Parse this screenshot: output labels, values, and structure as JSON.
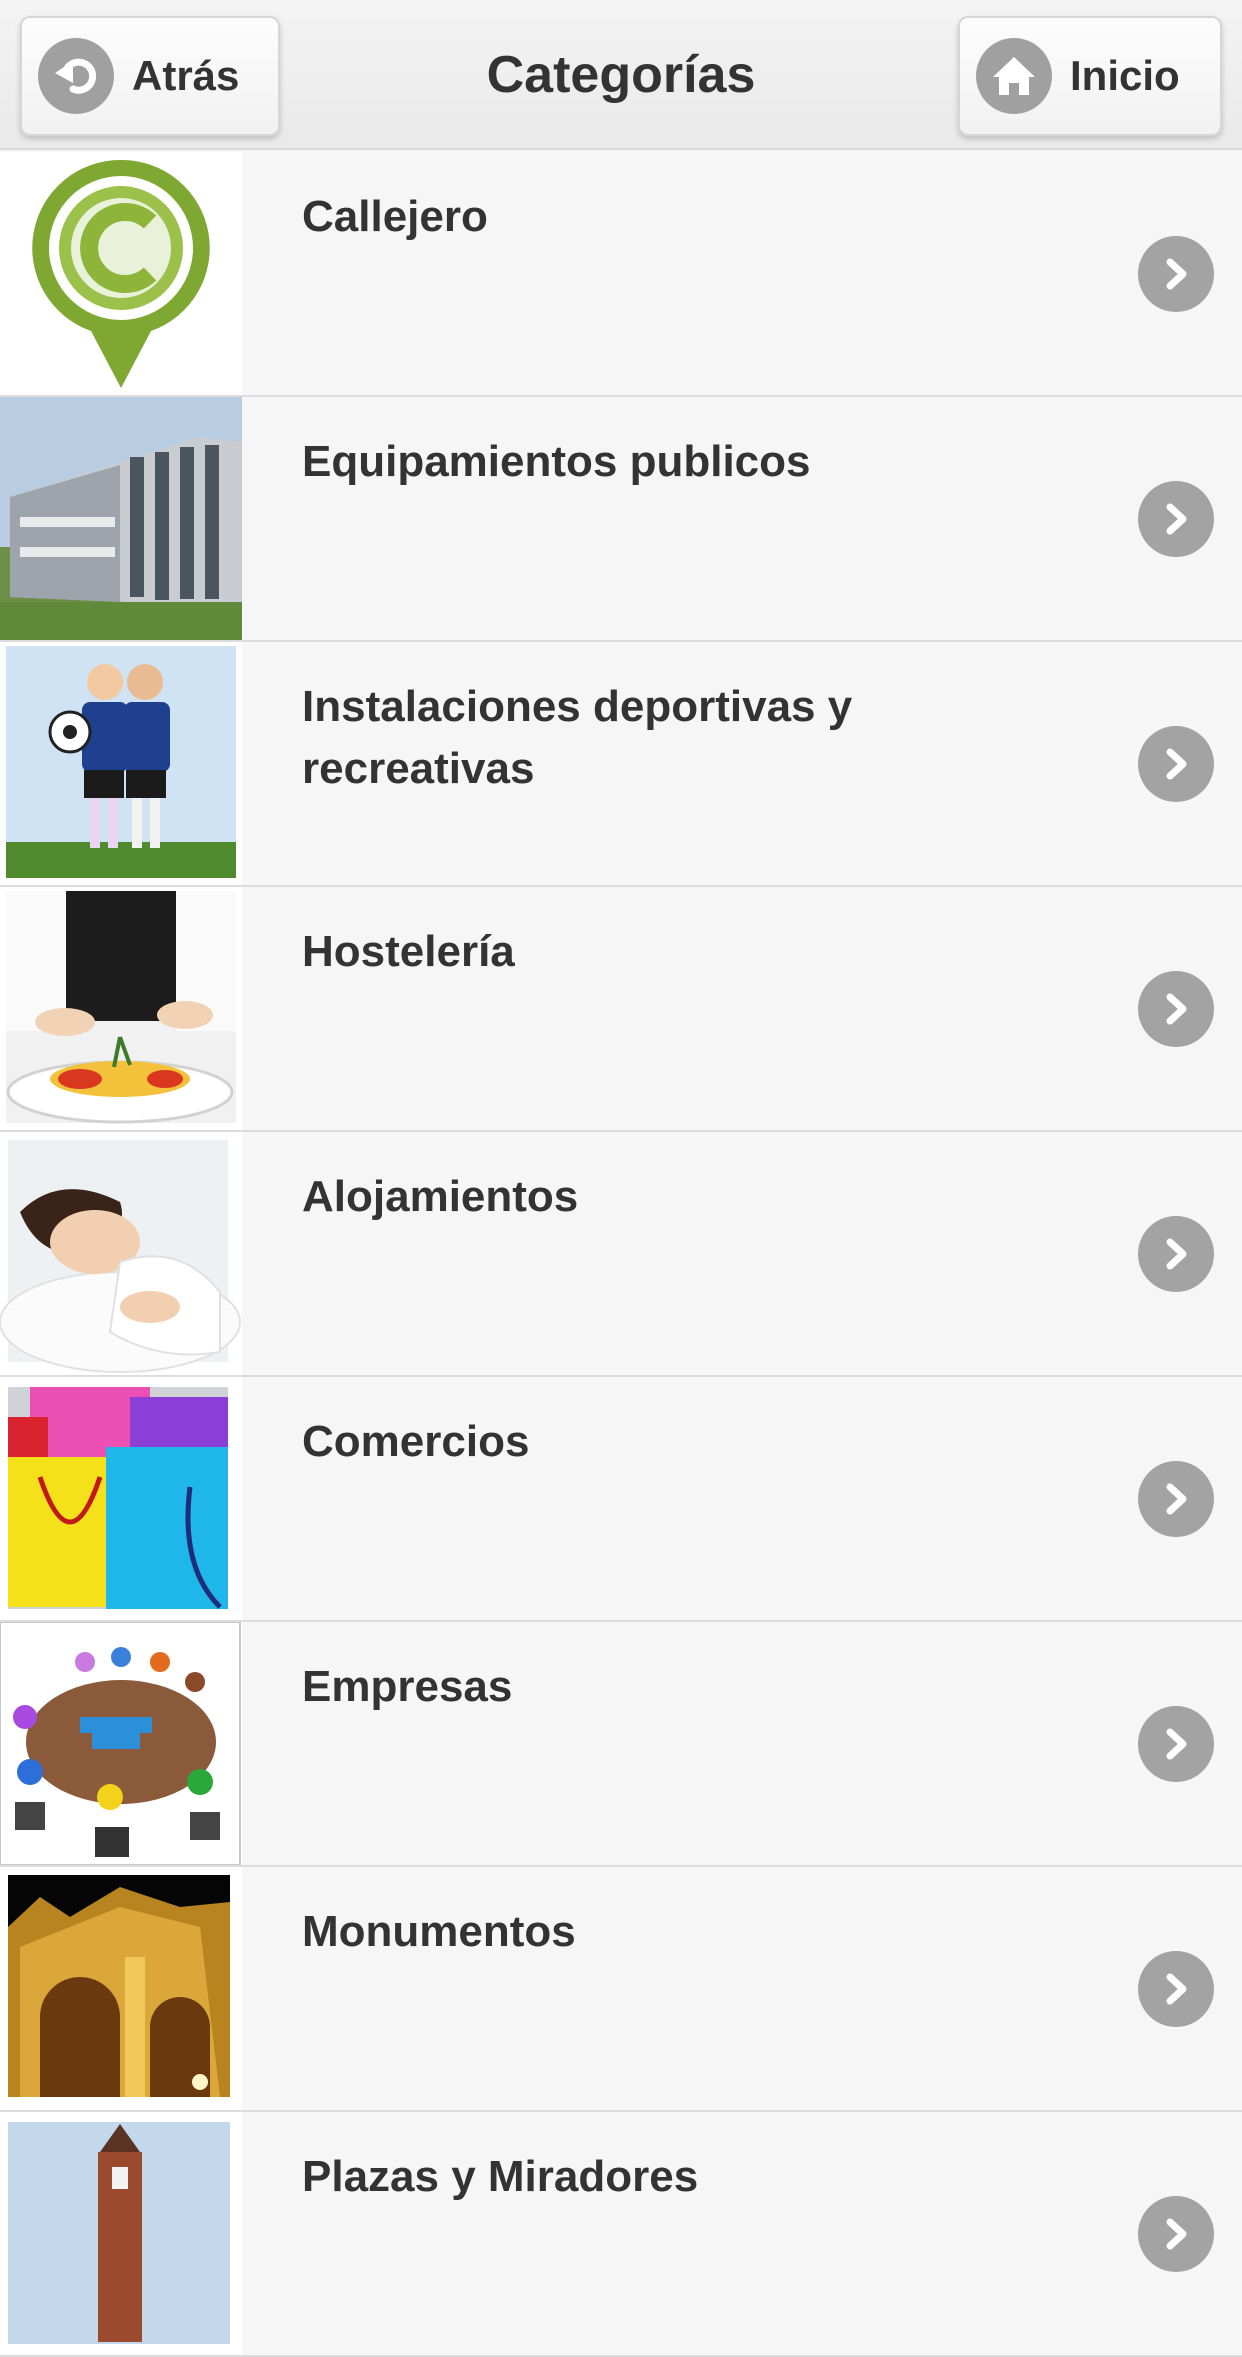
{
  "header": {
    "title": "Categorías",
    "back_label": "Atrás",
    "home_label": "Inicio",
    "back_icon": "back-arrow-icon",
    "home_icon": "home-icon"
  },
  "categories": [
    {
      "label": "Callejero",
      "thumb": "callejero-logo"
    },
    {
      "label": "Equipamientos publicos",
      "thumb": "public-building-photo"
    },
    {
      "label": "Instalaciones deportivas y recreativas",
      "thumb": "kids-soccer-photo"
    },
    {
      "label": "Hostelería",
      "thumb": "chef-plating-photo"
    },
    {
      "label": "Alojamientos",
      "thumb": "sleeping-woman-photo"
    },
    {
      "label": "Comercios",
      "thumb": "shopping-bags-photo"
    },
    {
      "label": "Empresas",
      "thumb": "round-table-meeting-photo"
    },
    {
      "label": "Monumentos",
      "thumb": "illuminated-monument-photo"
    },
    {
      "label": "Plazas y Miradores",
      "thumb": "tower-photo"
    }
  ],
  "colors": {
    "accent_green": "#8cb53a",
    "chevron_gray": "#a3a3a3",
    "text": "#333333"
  }
}
